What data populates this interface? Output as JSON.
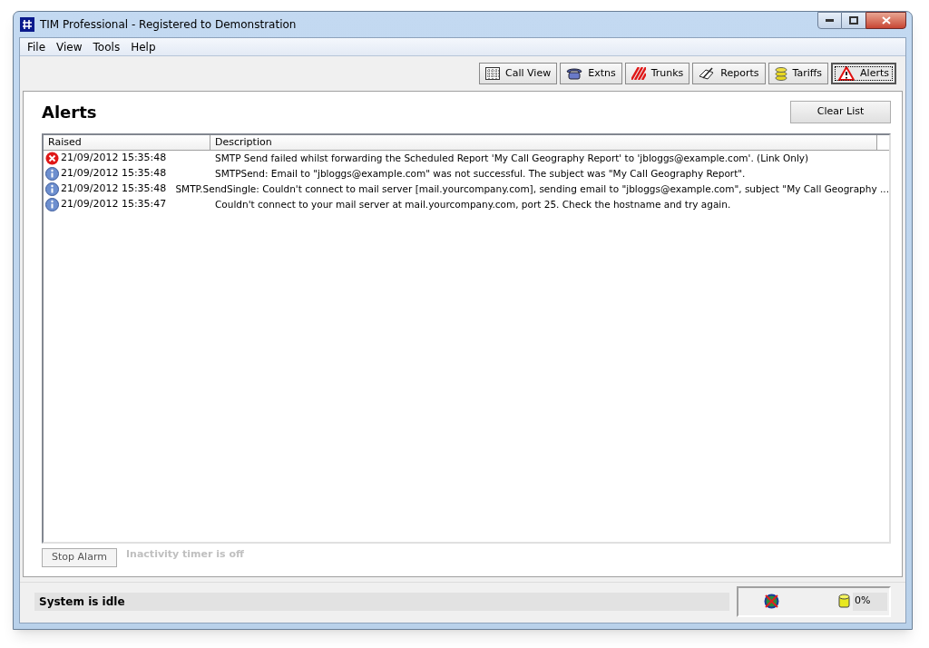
{
  "window": {
    "title": "TIM Professional - Registered to Demonstration"
  },
  "menu": [
    "File",
    "View",
    "Tools",
    "Help"
  ],
  "toolbar": [
    {
      "label": "Call View",
      "kind": "calls",
      "selected": false
    },
    {
      "label": "Extns",
      "kind": "phone",
      "selected": false
    },
    {
      "label": "Trunks",
      "kind": "trunks",
      "selected": false
    },
    {
      "label": "Reports",
      "kind": "reports",
      "selected": false
    },
    {
      "label": "Tariffs",
      "kind": "coins",
      "selected": false
    },
    {
      "label": "Alerts",
      "kind": "alert",
      "selected": true
    }
  ],
  "page": {
    "title": "Alerts",
    "clear_button": "Clear List"
  },
  "table": {
    "columns": [
      "Raised",
      "Description"
    ],
    "rows": [
      {
        "kind": "error",
        "raised": "21/09/2012 15:35:48",
        "description": "SMTP Send failed whilst forwarding the Scheduled Report 'My Call Geography Report' to 'jbloggs@example.com'. (Link Only)"
      },
      {
        "kind": "info",
        "raised": "21/09/2012 15:35:48",
        "description": "SMTPSend: Email to \"jbloggs@example.com\" was not successful.  The subject was \"My Call Geography Report\"."
      },
      {
        "kind": "info",
        "raised": "21/09/2012 15:35:48",
        "description": "SMTP.SendSingle:  Couldn't connect to mail server [mail.yourcompany.com], sending email to \"jbloggs@example.com\", subject \"My Call Geography ..."
      },
      {
        "kind": "info",
        "raised": "21/09/2012 15:35:47",
        "description": "Couldn't connect to your mail server at mail.yourcompany.com, port 25.  Check the hostname and try again."
      }
    ]
  },
  "stop_alarm": {
    "label": "Stop Alarm",
    "disabled": true
  },
  "inactivity": "Inactivity timer is off",
  "status_bar": {
    "message": "System is idle",
    "percent": "0%"
  }
}
